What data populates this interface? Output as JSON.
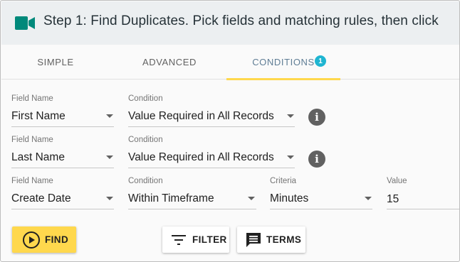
{
  "header": {
    "title": "Step 1: Find Duplicates. Pick fields and matching rules, then click",
    "icon": "video-camera-icon",
    "icon_color": "#00897b"
  },
  "tabs": [
    {
      "label": "SIMPLE"
    },
    {
      "label": "ADVANCED"
    },
    {
      "label": "CONDITIONS",
      "badge": "1",
      "active": true
    }
  ],
  "accent_color": "#ffd84d",
  "badge_color": "#1fb5d1",
  "rows": [
    {
      "field_label": "Field Name",
      "field_value": "First Name",
      "condition_label": "Condition",
      "condition_value": "Value Required in All Records"
    },
    {
      "field_label": "Field Name",
      "field_value": "Last Name",
      "condition_label": "Condition",
      "condition_value": "Value Required in All Records"
    },
    {
      "field_label": "Field Name",
      "field_value": "Create Date",
      "condition_label": "Condition",
      "condition_value": "Within Timeframe",
      "criteria_label": "Criteria",
      "criteria_value": "Minutes",
      "value_label": "Value",
      "value_value": "15"
    }
  ],
  "buttons": {
    "find": "FIND",
    "filter": "FILTER",
    "terms": "TERMS"
  }
}
